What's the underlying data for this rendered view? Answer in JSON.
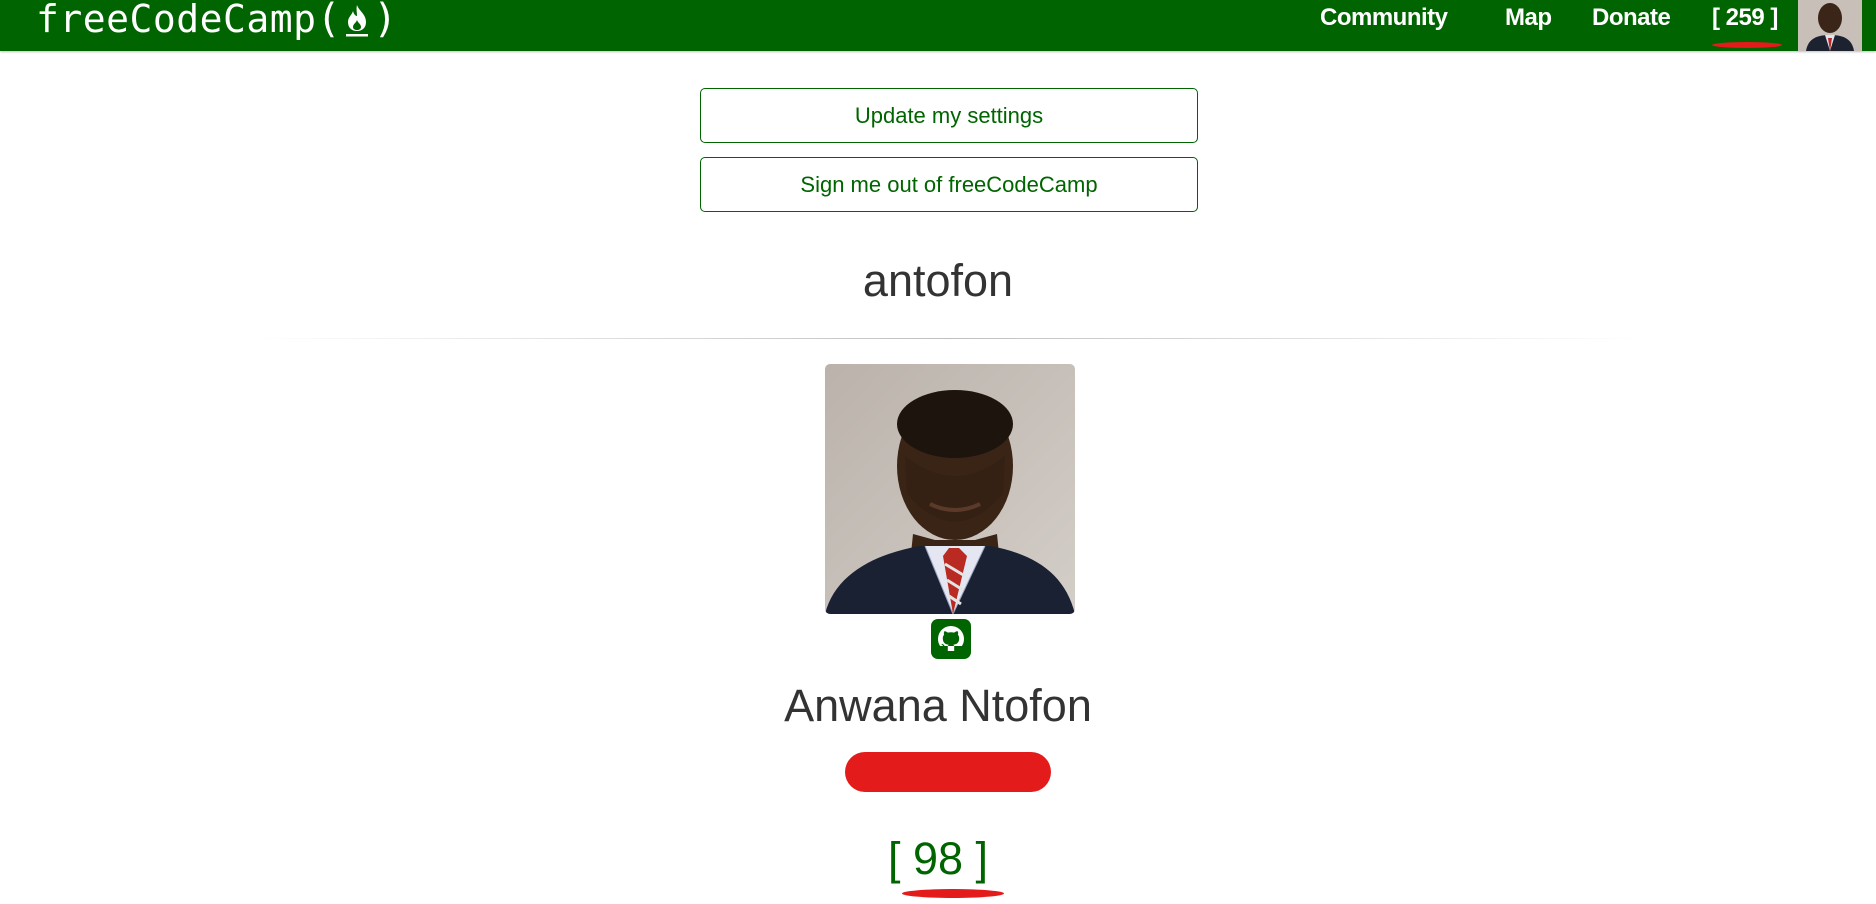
{
  "navbar": {
    "brand_text": "freeCodeCamp",
    "brand_open": "(",
    "brand_close": ")",
    "links": {
      "community": "Community",
      "map": "Map",
      "donate": "Donate",
      "points": "[ 259 ]"
    },
    "background": "#006400"
  },
  "actions": {
    "update_settings": "Update my settings",
    "sign_out": "Sign me out of freeCodeCamp"
  },
  "profile": {
    "username": "antofon",
    "full_name": "Anwana Ntofon",
    "points": "[ 98 ]",
    "social_icon": "github-icon"
  },
  "colors": {
    "accent": "#006400",
    "annotation": "#e31b1b"
  }
}
